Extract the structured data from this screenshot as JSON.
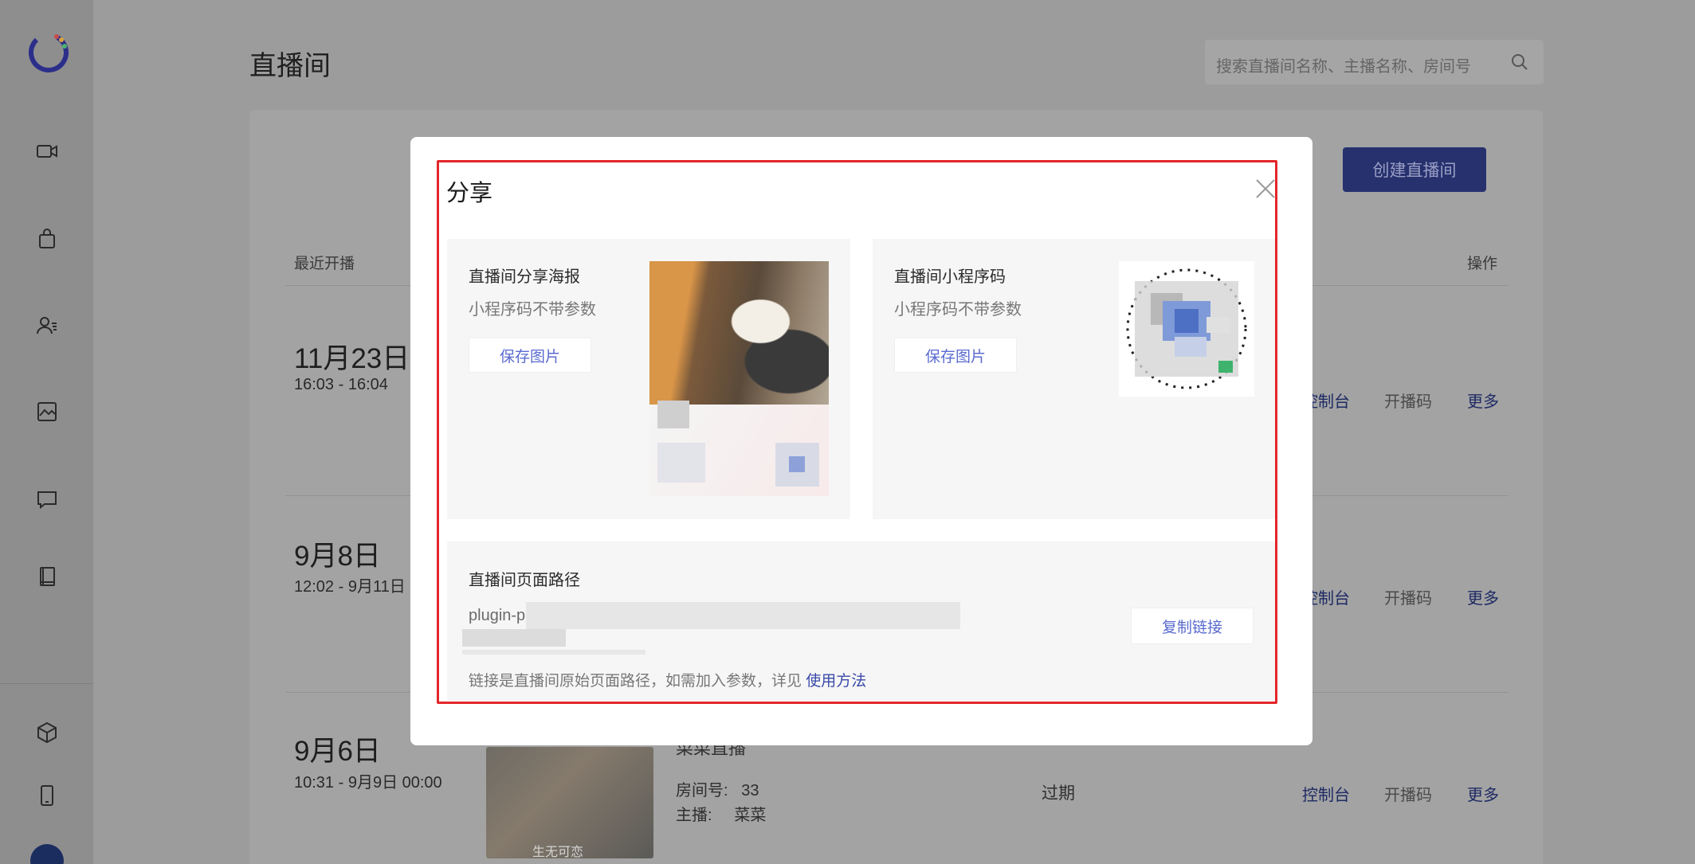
{
  "page": {
    "title": "直播间",
    "search_placeholder": "搜索直播间名称、主播名称、房间号",
    "create_button": "创建直播间"
  },
  "sidebar": {
    "icons": [
      "video-icon",
      "bag-icon",
      "user-list-icon",
      "image-icon",
      "chat-icon",
      "book-icon",
      "cube-icon",
      "phone-icon"
    ]
  },
  "table": {
    "headers": {
      "recent": "最近开播",
      "actions": "操作"
    },
    "rows": [
      {
        "date": "11月23日",
        "time": "16:03 - 16:04",
        "actions": [
          "控制台",
          "开播码",
          "更多"
        ]
      },
      {
        "date": "9月8日",
        "time": "12:02 - 9月11日",
        "actions": [
          "控制台",
          "开播码",
          "更多"
        ]
      },
      {
        "date": "9月6日",
        "time": "10:31 - 9月9日 00:00",
        "title": "菜菜直播",
        "room_label": "房间号:",
        "room": "33",
        "host_label": "主播:",
        "host": "菜菜",
        "status": "过期",
        "thumb_caption": "生无可恋",
        "actions": [
          "控制台",
          "开播码",
          "更多"
        ]
      }
    ]
  },
  "modal": {
    "title": "分享",
    "poster": {
      "title": "直播间分享海报",
      "subtitle": "小程序码不带参数",
      "button": "保存图片"
    },
    "qrcode": {
      "title": "直播间小程序码",
      "subtitle": "小程序码不带参数",
      "button": "保存图片"
    },
    "path": {
      "title": "直播间页面路径",
      "value": "plugin-p",
      "copy_button": "复制链接"
    },
    "note": {
      "text": "链接是直播间原始页面路径，如需加入参数，详见 ",
      "link": "使用方法"
    }
  },
  "colors": {
    "accent": "#5a6bcf",
    "highlight": "#e3262a",
    "primary_dark": "#27316e"
  }
}
